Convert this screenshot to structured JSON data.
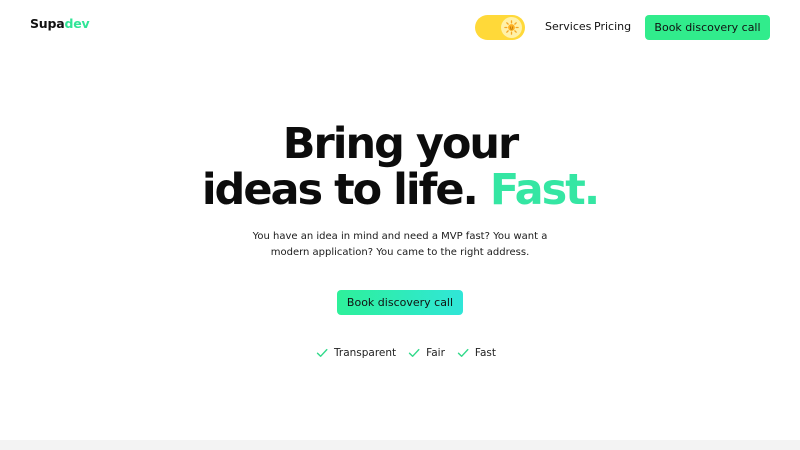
{
  "brand": {
    "name_part1": "Supa",
    "name_part2": "dev",
    "accent_color": "#31e597"
  },
  "header": {
    "theme_toggle": {
      "icon": "sun-icon",
      "color": "#ffd939"
    },
    "nav": [
      {
        "label": "Services"
      },
      {
        "label": "Pricing"
      }
    ],
    "cta_label": "Book discovery call"
  },
  "hero": {
    "headline_line1": "Bring your",
    "headline_line2_part1": "ideas to life.",
    "headline_line2_accent": "Fast.",
    "subtitle_line1": "You have an idea in mind and need a MVP fast? You want a",
    "subtitle_line2": "modern application? You came to the right address.",
    "cta_label": "Book discovery call",
    "features": [
      {
        "icon": "check-icon",
        "label": "Transparent"
      },
      {
        "icon": "check-icon",
        "label": "Fair"
      },
      {
        "icon": "check-icon",
        "label": "Fast"
      }
    ]
  },
  "colors": {
    "cta_green": "#31ec8c",
    "accent_teal": "#35e6a3",
    "toggle_yellow": "#ffd939"
  }
}
